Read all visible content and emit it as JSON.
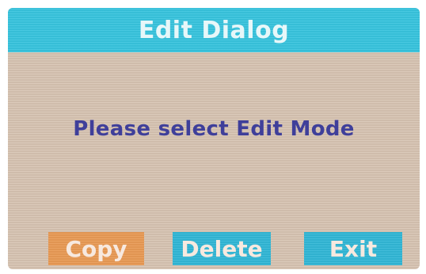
{
  "dialog": {
    "title": "Edit Dialog",
    "message": "Please select Edit Mode"
  },
  "buttons": {
    "copy_label": "Copy",
    "delete_label": "Delete",
    "exit_label": "Exit"
  },
  "colors": {
    "title_bar": "#38c4de",
    "background": "#d7c4b2",
    "message_text": "#3f3f9a",
    "copy_button": "#e89a55",
    "action_button": "#32b7d6"
  }
}
